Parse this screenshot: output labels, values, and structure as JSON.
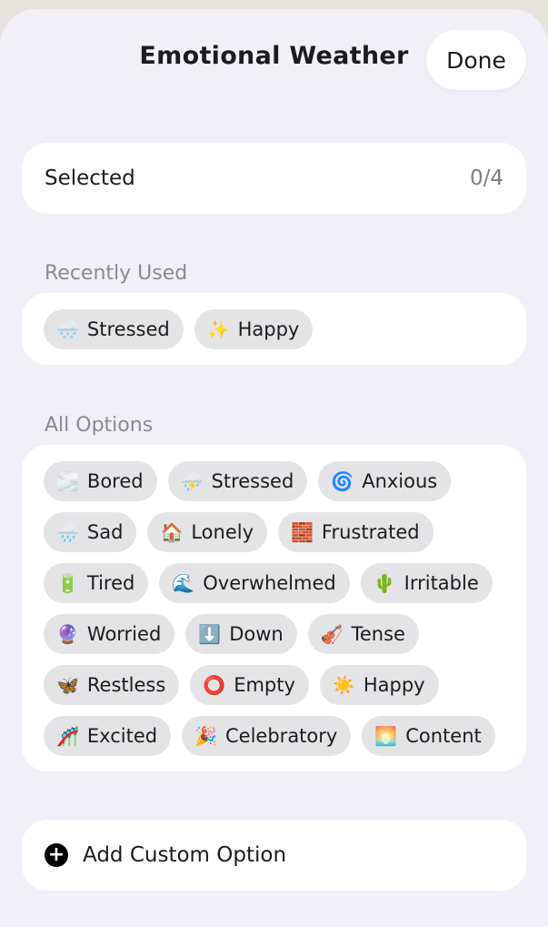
{
  "header": {
    "title": "Emotional Weather",
    "done_label": "Done"
  },
  "selected": {
    "label": "Selected",
    "count": "0/4"
  },
  "recent": {
    "label": "Recently Used",
    "chips": [
      {
        "emoji": "🌨️",
        "label": "Stressed"
      },
      {
        "emoji": "✨",
        "label": "Happy"
      }
    ]
  },
  "all": {
    "label": "All Options",
    "chips": [
      {
        "emoji": "🌫️",
        "label": "Bored"
      },
      {
        "emoji": "⛈️",
        "label": "Stressed"
      },
      {
        "emoji": "🌀",
        "label": "Anxious"
      },
      {
        "emoji": "🌧️",
        "label": "Sad"
      },
      {
        "emoji": "🏠",
        "label": "Lonely"
      },
      {
        "emoji": "🧱",
        "label": "Frustrated"
      },
      {
        "emoji": "🔋",
        "label": "Tired"
      },
      {
        "emoji": "🌊",
        "label": "Overwhelmed"
      },
      {
        "emoji": "🌵",
        "label": "Irritable"
      },
      {
        "emoji": "🔮",
        "label": "Worried"
      },
      {
        "emoji": "⬇️",
        "label": "Down"
      },
      {
        "emoji": "🎻",
        "label": "Tense"
      },
      {
        "emoji": "🦋",
        "label": "Restless"
      },
      {
        "emoji": "⭕",
        "label": "Empty"
      },
      {
        "emoji": "☀️",
        "label": "Happy"
      },
      {
        "emoji": "🎢",
        "label": "Excited"
      },
      {
        "emoji": "🎉",
        "label": "Celebratory"
      },
      {
        "emoji": "🌅",
        "label": "Content"
      }
    ]
  },
  "custom": {
    "label": "Add Custom Option",
    "icon": "plus-circle-icon"
  }
}
